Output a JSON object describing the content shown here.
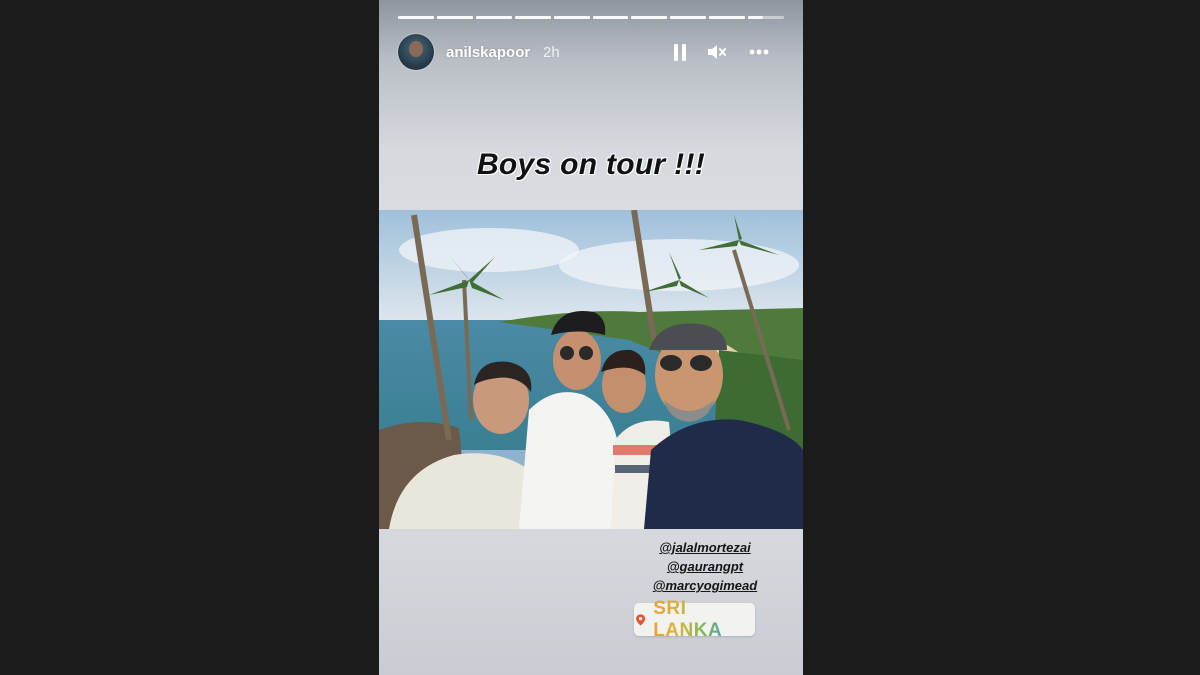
{
  "story": {
    "progress_segments": 10,
    "current_segment_progress": 0.4,
    "username": "anilskapoor",
    "time_ago": "2h",
    "caption": "Boys on tour !!!",
    "mentions": [
      "@jalalmortezai",
      "@gaurangpt",
      "@marcyogimead"
    ],
    "location": "SRI LANKA"
  },
  "icons": {
    "avatar": "profile-avatar",
    "pause": "pause-icon",
    "mute": "speaker-muted-icon",
    "more": "more-horizontal-icon",
    "location": "location-pin-icon"
  },
  "colors": {
    "page_background": "#1b1b1b",
    "caption_text": "#111111",
    "pin": "#e0553a"
  }
}
